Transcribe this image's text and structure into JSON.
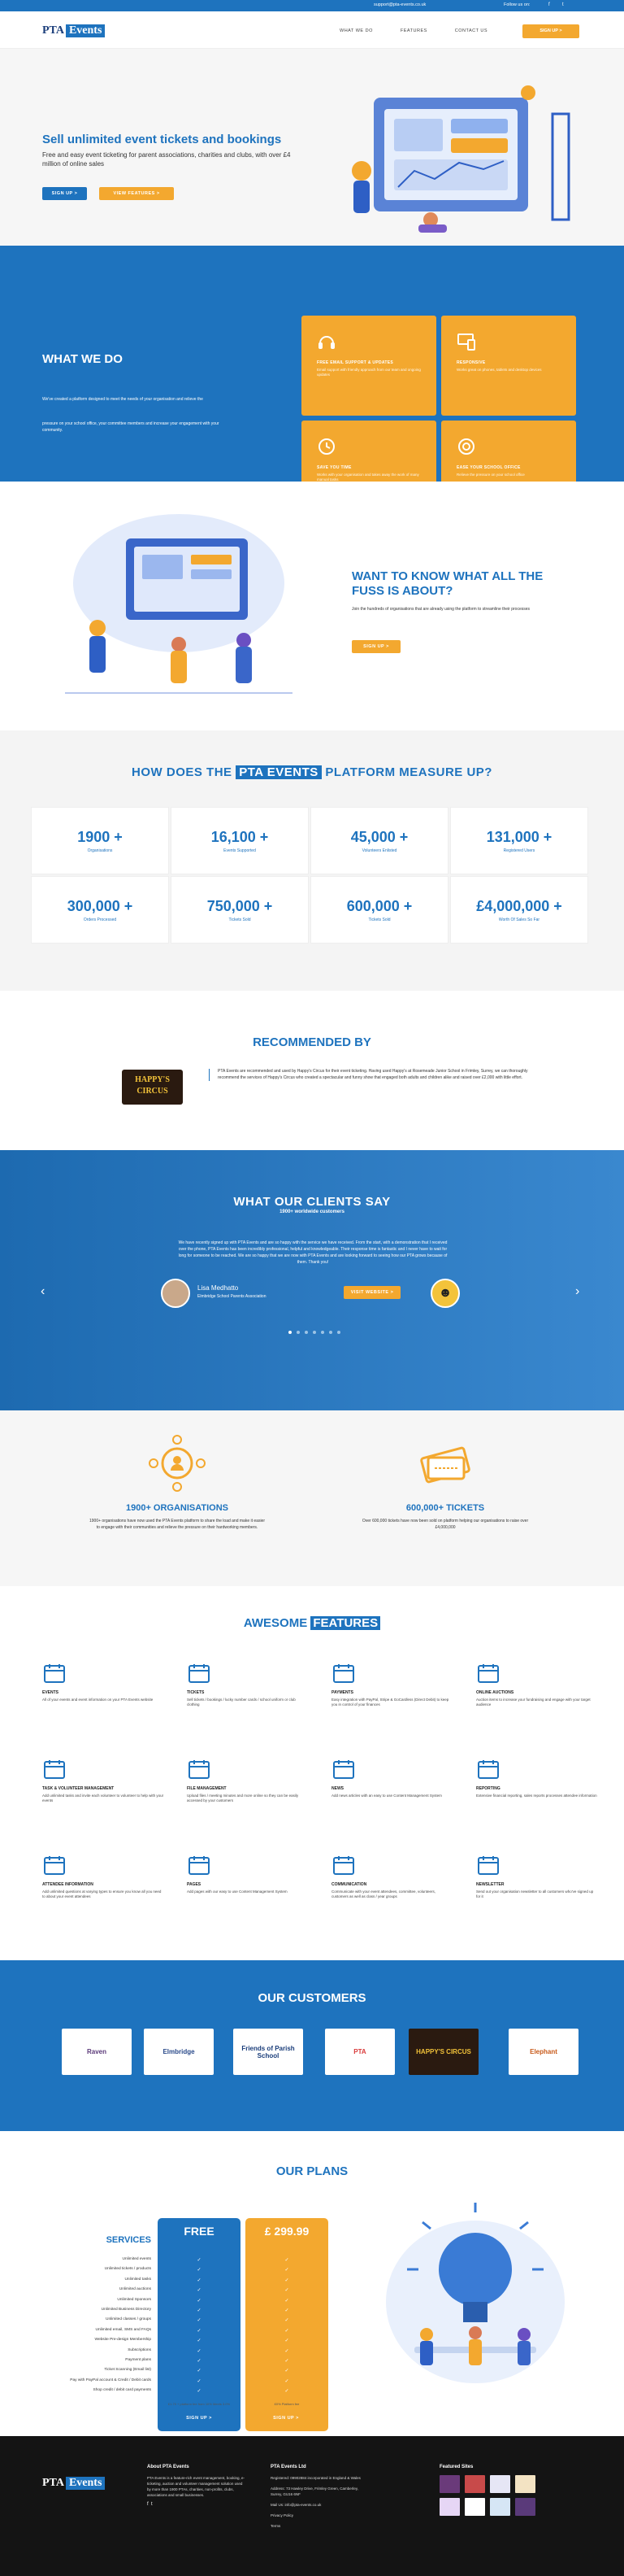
{
  "topbar": {
    "email": "support@pta-events.co.uk",
    "follow": "Follow us on:",
    "fb": "f",
    "tw": "t"
  },
  "nav": {
    "logo_a": "PTA",
    "logo_b": "Events",
    "links": [
      "WHAT WE DO",
      "FEATURES",
      "CONTACT US"
    ],
    "signup": "SIGN UP >"
  },
  "hero": {
    "title": "Sell unlimited event tickets and bookings",
    "text": "Free and easy event ticketing for parent associations, charities and clubs, with over £4 million of online sales",
    "btn1": "SIGN UP >",
    "btn2": "VIEW FEATURES >"
  },
  "wwd": {
    "title": "WHAT WE DO",
    "d1": "We've created a platform designed to meet the needs of your organisation and relieve the",
    "d2": "pressure on your school office, your committee members and increase your engagement with your community.",
    "cards": [
      {
        "t": "FREE EMAIL SUPPORT & UPDATES",
        "s": "Email support with friendly approach from our team and ongoing updates"
      },
      {
        "t": "RESPONSIVE",
        "s": "Works great on phones, tablets and desktop devices"
      },
      {
        "t": "SAVE YOU TIME",
        "s": "Works with your organisation and takes away the work of many manual tasks"
      },
      {
        "t": "EASE YOUR SCHOOL OFFICE",
        "s": "Relieve the pressure on your school office"
      }
    ]
  },
  "fuss": {
    "title": "WANT TO KNOW WHAT ALL THE FUSS IS ABOUT?",
    "text": "Join the hundreds of organisations that are already using the platform to streamline their processes",
    "btn": "SIGN UP >"
  },
  "measure": {
    "title_a": "HOW DOES THE",
    "title_hl": "PTA EVENTS",
    "title_b": "PLATFORM MEASURE UP?",
    "stats": [
      {
        "n": "1900 +",
        "l": "Organisations"
      },
      {
        "n": "16,100 +",
        "l": "Events Supported"
      },
      {
        "n": "45,000 +",
        "l": "Volunteers Enlisted"
      },
      {
        "n": "131,000 +",
        "l": "Registered Users"
      },
      {
        "n": "300,000 +",
        "l": "Orders Processed"
      },
      {
        "n": "750,000 +",
        "l": "Tickets Sold"
      },
      {
        "n": "600,000 +",
        "l": "Tickets Sold"
      },
      {
        "n": "£4,000,000 +",
        "l": "Worth Of Sales So Far"
      }
    ]
  },
  "rec": {
    "title": "RECOMMENDED BY",
    "logo": "HAPPY'S CIRCUS",
    "text": "PTA Events are recommended and used by Happy's Circus for their event ticketing. Having used Happy's at Rosemeade Junior School in Frimley, Surrey, we can thoroughly recommend the services of Happy's Circus who created a spectacular and funny show that engaged both adults and children alike and raised over £2,000 with little effort."
  },
  "test": {
    "title_a": "WHAT OUR",
    "title_b": "CLIENTS SAY",
    "sub": "1900+ worldwide customers",
    "quote": "We have recently signed up with PTA Events and are so happy with the service we have received. From the start, with a demonstration that I received over the phone, PTA Events has been incredibly professional, helpful and knowledgeable. Their response time is fantastic and I never have to wait for long for someone to be reached. We are so happy that we are now with PTA Events and are looking forward to seeing how our PTA grows because of them. Thank you!",
    "name": "Lisa Medhatto",
    "role": "Elmbridge School Parents Association",
    "btn": "VISIT WEBSITE >",
    "prev": "‹",
    "next": "›"
  },
  "ot": {
    "h1": "1900+ ORGANISATIONS",
    "p1": "1900+ organisations have now used the PTA Events platform to share the load and make it easier to engage with their communities and relieve the pressure on their hardworking members.",
    "h2": "600,000+ TICKETS",
    "p2": "Over 600,000 tickets have now been sold on platform helping our organisations to raise over £4,000,000"
  },
  "feat": {
    "title_a": "AWESOME",
    "title_hl": "FEATURES",
    "items": [
      {
        "t": "EVENTS",
        "s": "All of your events and event information on your PTA Events website"
      },
      {
        "t": "TICKETS",
        "s": "Sell tickets / bookings / lucky number cards / school uniform or club clothing"
      },
      {
        "t": "PAYMENTS",
        "s": "Easy integration with PayPal, Stripe & GoCardless (Direct Debit) to keep you in control of your finances"
      },
      {
        "t": "ONLINE AUCTIONS",
        "s": "Auction items to increase your fundraising and engage with your target audience"
      },
      {
        "t": "TASK & VOLUNTEER MANAGEMENT",
        "s": "Add unlimited tasks and invite each volunteer to volunteer to help with your events"
      },
      {
        "t": "FILE MANAGEMENT",
        "s": "Upload files / meeting minutes and more online so they can be easily accessed by your customers"
      },
      {
        "t": "NEWS",
        "s": "Add news articles with an easy to use Content Management System"
      },
      {
        "t": "REPORTING",
        "s": "Extensive financial reporting, sales reports processes attendee information"
      },
      {
        "t": "ATTENDEE INFORMATION",
        "s": "Add unlimited questions at varying types to ensure you know all you need to about your event attendees"
      },
      {
        "t": "PAGES",
        "s": "Add pages with our easy to use Content Management System"
      },
      {
        "t": "COMMUNICATION",
        "s": "Communicate with your event attendees, committee, volunteers, customers as well as class / year groups"
      },
      {
        "t": "NEWSLETTER",
        "s": "Send out your organisation newsletter to all customers who've signed up for it"
      }
    ]
  },
  "cust": {
    "title_a": "OUR",
    "title_b": "CUSTOMERS",
    "logos": [
      "Raven",
      "Elmbridge",
      "Friends of Parish School",
      "PTA",
      "HAPPY'S CIRCUS",
      "Elephant"
    ]
  },
  "plans": {
    "title": "OUR PLANS",
    "services": "SERVICES",
    "free": "FREE",
    "paid": "£ 299.99",
    "rows": [
      "Unlimited events",
      "Unlimited tickets / products",
      "Unlimited tasks",
      "Unlimited auctions",
      "Unlimited Sponsors",
      "Unlimited Business Directory",
      "Unlimited classes / groups",
      "Unlimited email, SMS and FAQs",
      "Website Pre-design Membership",
      "Subscriptions",
      "Payment plans",
      "Ticket Scanning (Email list)",
      "Pay with PayPal account & Credit / Debit cards",
      "Shop credit / debit card payments"
    ],
    "free_ticks": [
      "✓",
      "✓",
      "✓",
      "✓",
      "✓",
      "✓",
      "✓",
      "✓",
      "✓",
      "✓",
      "✓",
      "✓",
      "✓",
      "✓"
    ],
    "paid_ticks": [
      "✓",
      "✓",
      "✓",
      "✓",
      "✓",
      "✓",
      "✓",
      "✓",
      "✓",
      "✓",
      "✓",
      "✓",
      "✓",
      "✓"
    ],
    "note1": "£1.70 + platform fee from 10% Meets 3.0%",
    "note2": "£0% Platform fee",
    "btn1": "SIGN UP >",
    "btn2": "SIGN UP >"
  },
  "footer": {
    "about_t": "About PTA Events",
    "about": "PTA Events is a feature-rich event management, booking, e-ticketing, auction and volunteer management solution used by more than 1900 PTAs, charities, non-profits, clubs, associations and small businesses.",
    "ltd_t": "PTA Events Ltd",
    "ltd": "Registered: 09902884 incorporated in England & Wales",
    "addr": "Address: 73 Hawley Drive, Frimley Green, Camberley, Surrey, GU16 6NF",
    "mail": "Mail Us: info@pta-events.co.uk",
    "priv": "Privacy Policy",
    "terms": "Terms",
    "sites_t": "Featured Sites"
  }
}
